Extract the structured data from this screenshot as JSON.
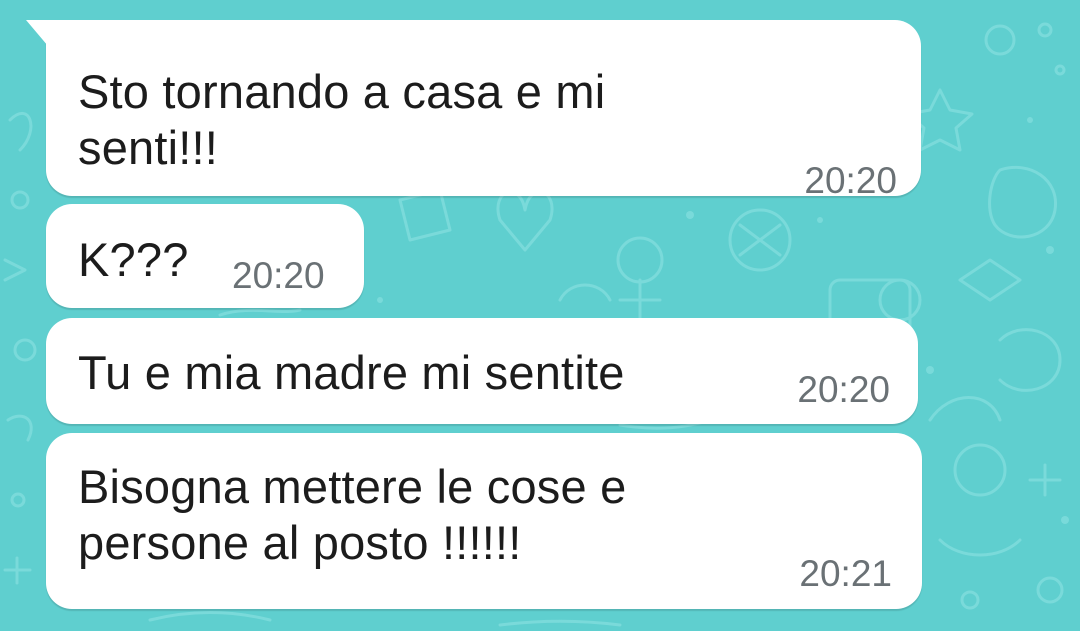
{
  "theme": {
    "wallpaper_color": "#5fcfcf",
    "bubble_color": "#ffffff",
    "text_color": "#1c1c1c",
    "time_color": "#6a7175"
  },
  "messages": [
    {
      "text": "Sto tornando a casa e mi\nsenti!!!",
      "time": "20:20"
    },
    {
      "text": "K???",
      "time": "20:20"
    },
    {
      "text": "Tu e mia madre mi sentite",
      "time": "20:20"
    },
    {
      "text": "Bisogna mettere le cose e\npersone al posto !!!!!!",
      "time": "20:21"
    }
  ]
}
